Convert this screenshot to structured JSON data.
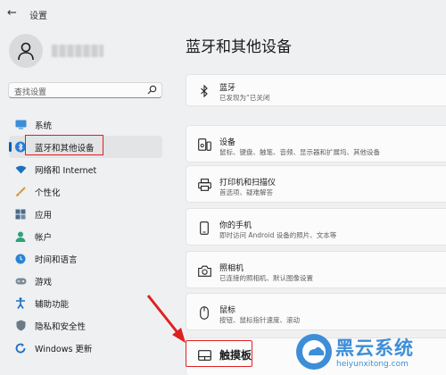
{
  "window": {
    "back_icon": "back-arrow-icon",
    "title": "设置"
  },
  "user": {
    "avatar_icon": "person-icon"
  },
  "search": {
    "placeholder": "查找设置",
    "icon": "search-icon"
  },
  "sidebar": {
    "items": [
      {
        "label": "系统",
        "icon": "monitor-icon"
      },
      {
        "label": "蓝牙和其他设备",
        "icon": "bluetooth-icon",
        "active": true
      },
      {
        "label": "网络和 Internet",
        "icon": "wifi-icon"
      },
      {
        "label": "个性化",
        "icon": "brush-icon"
      },
      {
        "label": "应用",
        "icon": "apps-icon"
      },
      {
        "label": "帐户",
        "icon": "account-icon"
      },
      {
        "label": "时间和语言",
        "icon": "globe-clock-icon"
      },
      {
        "label": "游戏",
        "icon": "gamepad-icon"
      },
      {
        "label": "辅助功能",
        "icon": "accessibility-icon"
      },
      {
        "label": "隐私和安全性",
        "icon": "shield-icon"
      },
      {
        "label": "Windows 更新",
        "icon": "update-icon"
      }
    ]
  },
  "main": {
    "title": "蓝牙和其他设备",
    "cards": [
      {
        "title": "蓝牙",
        "subtitle": "已发现为“已关闭",
        "icon": "bluetooth-icon"
      },
      {
        "title": "设备",
        "subtitle": "鼠标、键盘、触笔、音频、显示器和扩展坞、其他设备",
        "icon": "devices-icon"
      },
      {
        "title": "打印机和扫描仪",
        "subtitle": "首选项、疑难解答",
        "icon": "printer-icon"
      },
      {
        "title": "你的手机",
        "subtitle": "即时访问 Android 设备的照片、文本等",
        "icon": "phone-icon"
      },
      {
        "title": "照相机",
        "subtitle": "已连接的照相机、默认图像设置",
        "icon": "camera-icon"
      },
      {
        "title": "鼠标",
        "subtitle": "按钮、鼠标指针速度、滚动",
        "icon": "mouse-icon"
      },
      {
        "title": "触摸板",
        "icon": "touchpad-icon"
      }
    ]
  },
  "watermark": {
    "name": "黑云系统",
    "url": "heiyunxitong.com"
  },
  "colors": {
    "accent": "#005fb8",
    "highlight_red": "#e02020",
    "watermark_blue": "#3d8ed8"
  }
}
